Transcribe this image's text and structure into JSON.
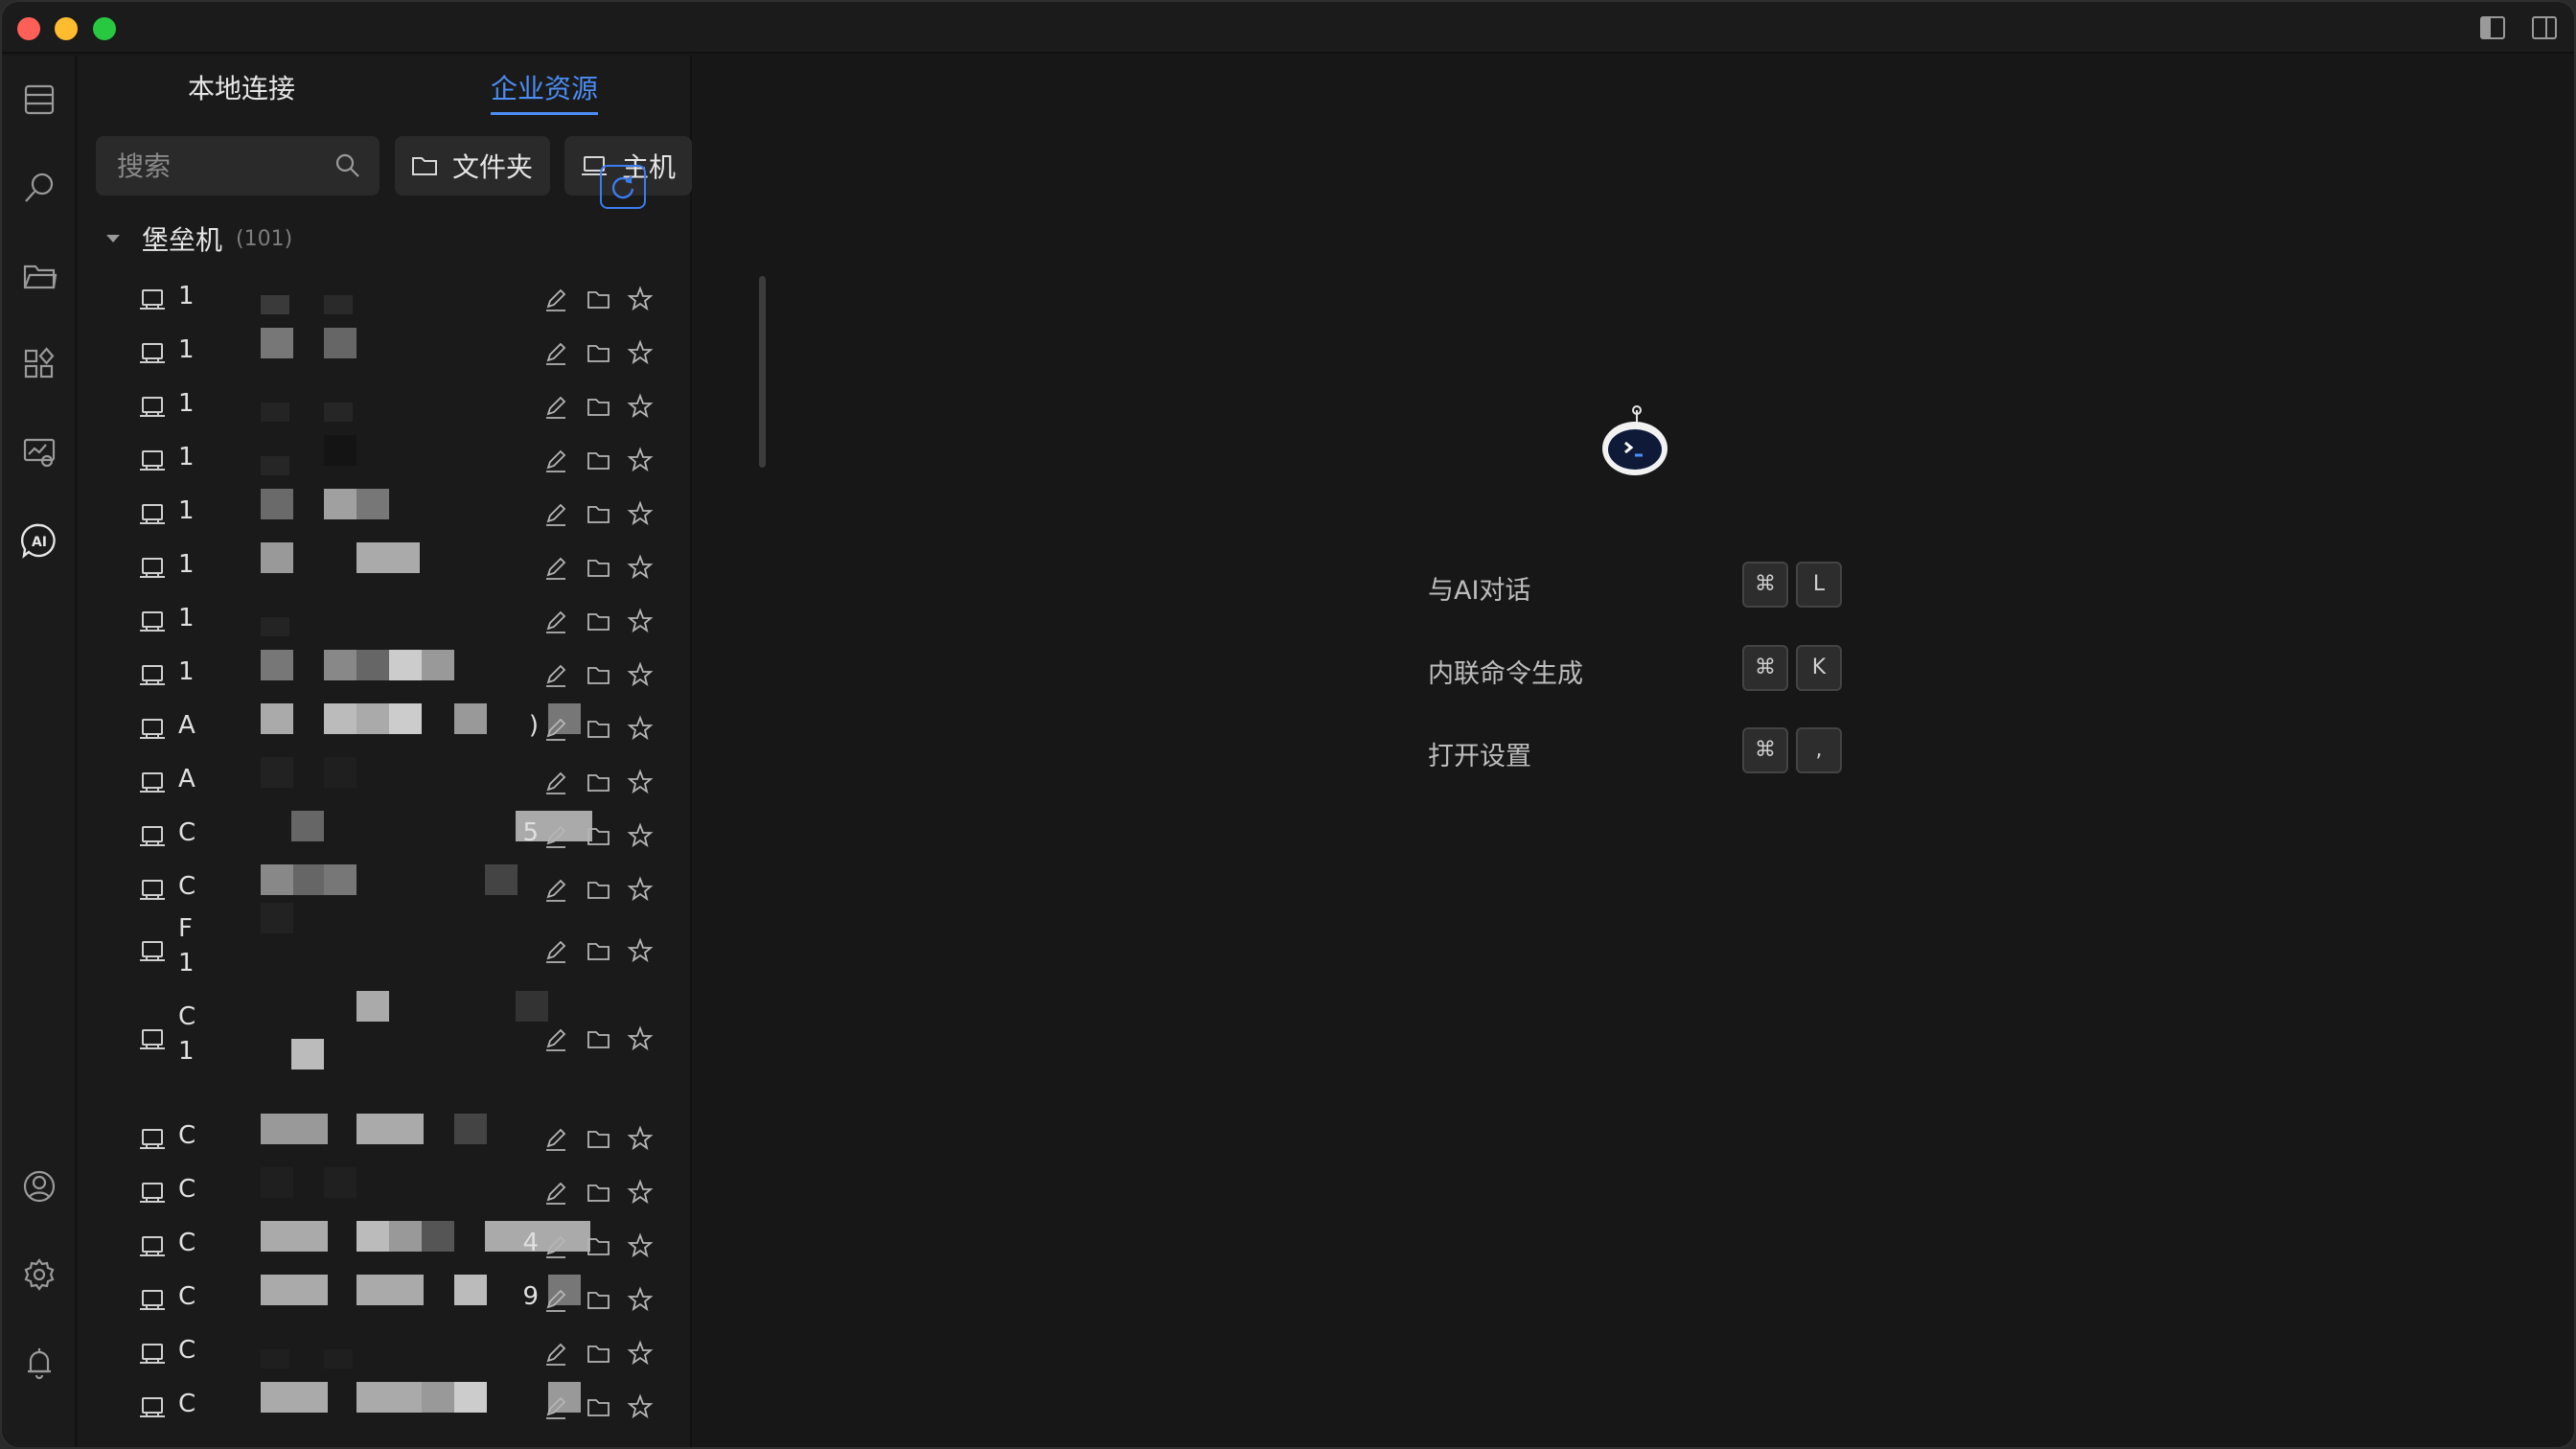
{
  "titlebar": {
    "icons": [
      "sidebar-left-icon",
      "sidebar-right-icon"
    ]
  },
  "rail": {
    "items": [
      {
        "name": "server-list-icon"
      },
      {
        "name": "search-icon"
      },
      {
        "name": "folder-icon"
      },
      {
        "name": "apps-icon"
      },
      {
        "name": "monitor-icon"
      },
      {
        "name": "ai-icon"
      },
      {
        "name": "user-icon"
      },
      {
        "name": "settings-icon"
      },
      {
        "name": "bell-icon"
      }
    ]
  },
  "panel": {
    "tabs": [
      {
        "label": "本地连接",
        "active": false
      },
      {
        "label": "企业资源",
        "active": true
      }
    ],
    "search": {
      "placeholder": "搜索"
    },
    "buttons": {
      "folder": "文件夹",
      "host": "主机"
    },
    "group": {
      "name": "堡垒机",
      "count": "(101)"
    },
    "hosts": [
      {
        "visible_text": "1"
      },
      {
        "visible_text": "1"
      },
      {
        "visible_text": "1"
      },
      {
        "visible_text": "1"
      },
      {
        "visible_text": "1"
      },
      {
        "visible_text": "1"
      },
      {
        "visible_text": "1"
      },
      {
        "visible_text": "1"
      },
      {
        "visible_text": "A",
        "suffix": ")"
      },
      {
        "visible_text": "A"
      },
      {
        "visible_text": "C",
        "suffix": "5"
      },
      {
        "visible_text": "C"
      },
      {
        "visible_text": "F",
        "line2": "1"
      },
      {
        "visible_text": "C",
        "line2": "1"
      },
      {
        "visible_text": "C"
      },
      {
        "visible_text": "C"
      },
      {
        "visible_text": "C",
        "suffix": "4"
      },
      {
        "visible_text": "C",
        "suffix": "9"
      },
      {
        "visible_text": "C"
      },
      {
        "visible_text": "C"
      }
    ]
  },
  "main": {
    "logo": "ai-terminal-robot-icon",
    "shortcuts": [
      {
        "label": "与AI对话",
        "keys": [
          "⌘",
          "L"
        ]
      },
      {
        "label": "内联命令生成",
        "keys": [
          "⌘",
          "K"
        ]
      },
      {
        "label": "打开设置",
        "keys": [
          "⌘",
          ","
        ]
      }
    ]
  },
  "colors": {
    "accent": "#4c8df6",
    "background": "#171717",
    "panel": "#1a1a1a",
    "text": "#e6e6e6"
  }
}
